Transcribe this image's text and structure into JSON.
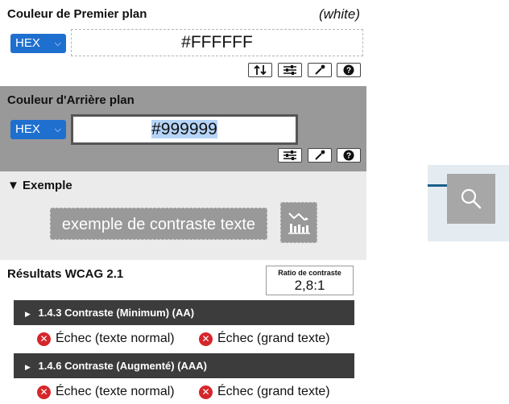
{
  "foreground": {
    "title": "Couleur de Premier plan",
    "color_name": "(white)",
    "format": "HEX",
    "hex_value": "#FFFFFF",
    "tools": [
      "swap-icon",
      "sliders-icon",
      "eyedropper-icon",
      "help-icon"
    ]
  },
  "background": {
    "title": "Couleur d'Arrière plan",
    "format": "HEX",
    "hex_value": "#999999",
    "tools": [
      "sliders-icon",
      "eyedropper-icon",
      "help-icon"
    ]
  },
  "example": {
    "title": "Exemple",
    "sample_text": "exemple de contraste texte",
    "chart_icon": "contrast-chart-icon"
  },
  "results": {
    "title": "Résultats WCAG 2.1",
    "ratio_label": "Ratio de contraste",
    "ratio_value": "2,8:1",
    "criteria": [
      {
        "label": "1.4.3 Contraste (Minimum) (AA)",
        "normal": "Échec (texte normal)",
        "large": "Échec (grand texte)"
      },
      {
        "label": "1.4.6 Contraste (Augmenté) (AAA)",
        "normal": "Échec (texte normal)",
        "large": "Échec (grand texte)"
      }
    ]
  },
  "colors": {
    "accent": "#1f6fcf",
    "background_sample": "#999999",
    "fail": "#d6262b",
    "criterion_bar": "#3c3c3c"
  },
  "search": {
    "icon": "search-icon"
  }
}
